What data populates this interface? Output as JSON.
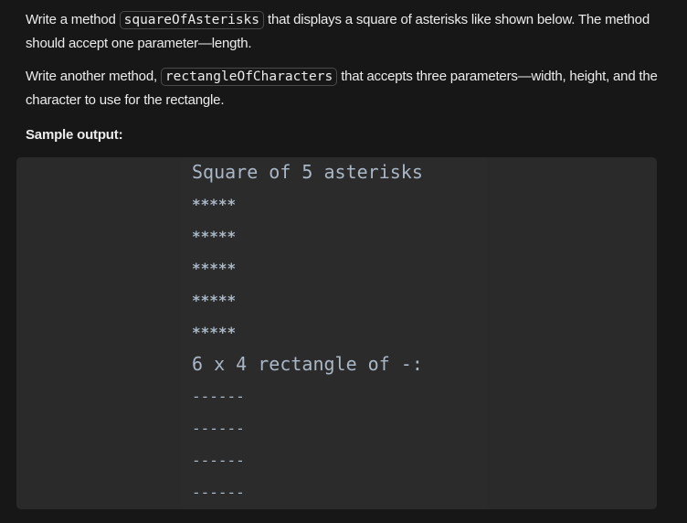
{
  "paragraph1": {
    "before": "Write a method ",
    "code": "squareOfAsterisks",
    "after": " that displays a square of asterisks like shown below. The method should accept one parameter—length."
  },
  "paragraph2": {
    "before": "Write another method, ",
    "code": "rectangleOfCharacters",
    "after": " that accepts three parameters—width, height, and the character to use for the rectangle."
  },
  "sample_label": "Sample output:",
  "output": {
    "square_header": "Square of 5 asterisks",
    "square_rows": [
      "*****",
      "*****",
      "*****",
      "*****",
      "*****"
    ],
    "rect_header": "6 x 4 rectangle of -:",
    "rect_rows": [
      "------",
      "------",
      "------",
      "------"
    ]
  }
}
